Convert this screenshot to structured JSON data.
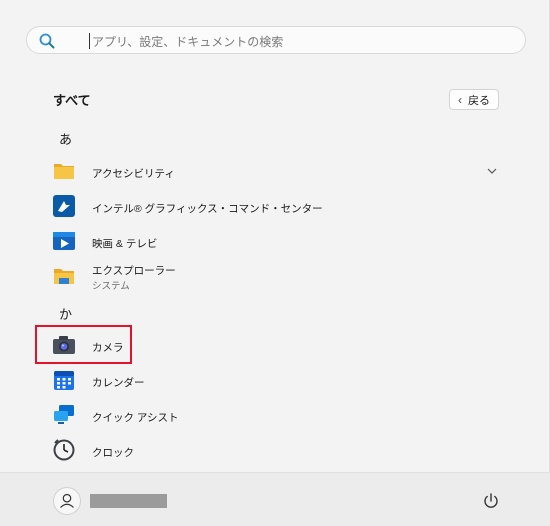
{
  "search": {
    "placeholder": "アプリ、設定、ドキュメントの検索"
  },
  "header": {
    "title": "すべて",
    "back_label": "戻る"
  },
  "groups": [
    {
      "letter": "あ"
    },
    {
      "letter": "か"
    }
  ],
  "apps": [
    {
      "label": "アクセシビリティ",
      "icon": "folder-icon"
    },
    {
      "label": "インテル® グラフィックス・コマンド・センター",
      "icon": "intel-graphics-icon"
    },
    {
      "label": "映画 & テレビ",
      "icon": "movies-tv-icon"
    },
    {
      "label": "エクスプローラー",
      "sub": "システム",
      "icon": "file-explorer-icon"
    },
    {
      "label": "カメラ",
      "icon": "camera-icon"
    },
    {
      "label": "カレンダー",
      "icon": "calendar-icon"
    },
    {
      "label": "クイック アシスト",
      "icon": "quick-assist-icon"
    },
    {
      "label": "クロック",
      "icon": "clock-icon"
    }
  ],
  "colors": {
    "highlight": "#e0142b",
    "accent": "#0067c0",
    "folder": "#f6c545"
  }
}
